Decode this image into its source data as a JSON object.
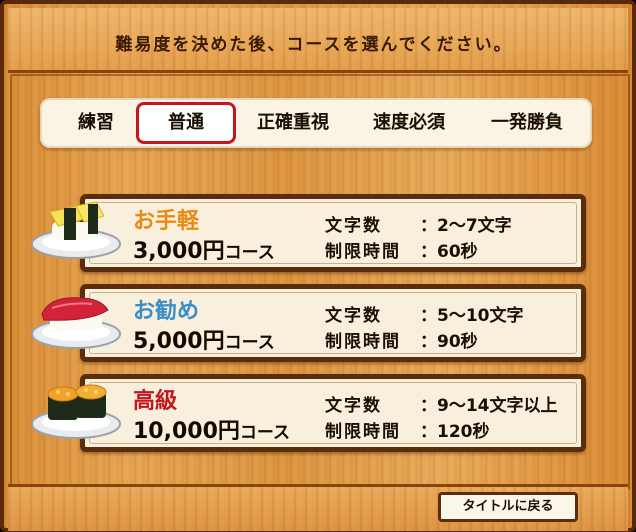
{
  "instruction": "難易度を決めた後、コースを選んでください。",
  "difficulty_tabs": [
    {
      "label": "練習",
      "selected": false
    },
    {
      "label": "普通",
      "selected": true
    },
    {
      "label": "正確重視",
      "selected": false
    },
    {
      "label": "速度必須",
      "selected": false
    },
    {
      "label": "一発勝負",
      "selected": false
    }
  ],
  "courses": [
    {
      "name": "お手軽",
      "name_color": "#e88a12",
      "price": "3,000円",
      "suffix": "コース",
      "char_label": "文字数",
      "char_value": "2〜7文字",
      "time_label": "制限時間",
      "time_value": "60秒",
      "sushi": "tamago"
    },
    {
      "name": "お勧め",
      "name_color": "#3a8ec8",
      "price": "5,000円",
      "suffix": "コース",
      "char_label": "文字数",
      "char_value": "5〜10文字",
      "time_label": "制限時間",
      "time_value": "90秒",
      "sushi": "maguro"
    },
    {
      "name": "高級",
      "name_color": "#c4161c",
      "price": "10,000円",
      "suffix": "コース",
      "char_label": "文字数",
      "char_value": "9〜14文字以上",
      "time_label": "制限時間",
      "time_value": "120秒",
      "sushi": "uni"
    }
  ],
  "back_button": "タイトルに戻る"
}
